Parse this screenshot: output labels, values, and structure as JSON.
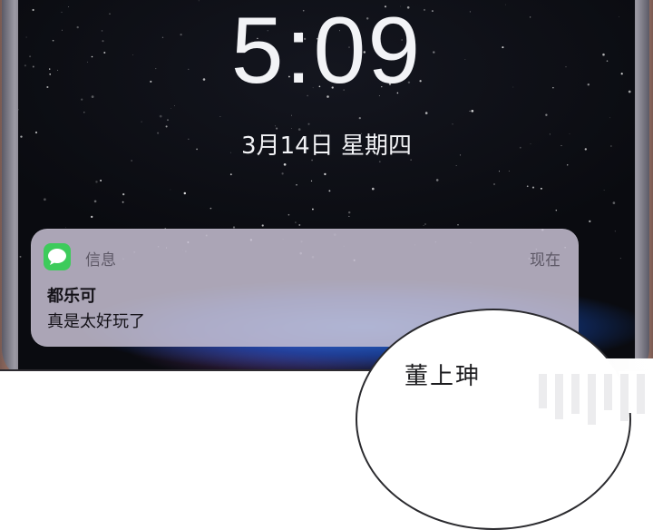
{
  "lock_screen": {
    "time": "5:09",
    "date": "3月14日 星期四"
  },
  "notification": {
    "app_icon": "messages-icon",
    "app_name": "信息",
    "timestamp": "现在",
    "sender": "都乐可",
    "message": "真是太好玩了"
  },
  "speech_bubble": {
    "text": "董上珅"
  },
  "colors": {
    "messages_green": "#3dcb5b",
    "notification_bg": "#c6bfd2",
    "screen_bg": "#0a0b10",
    "glow_blue": "#2878e6"
  }
}
